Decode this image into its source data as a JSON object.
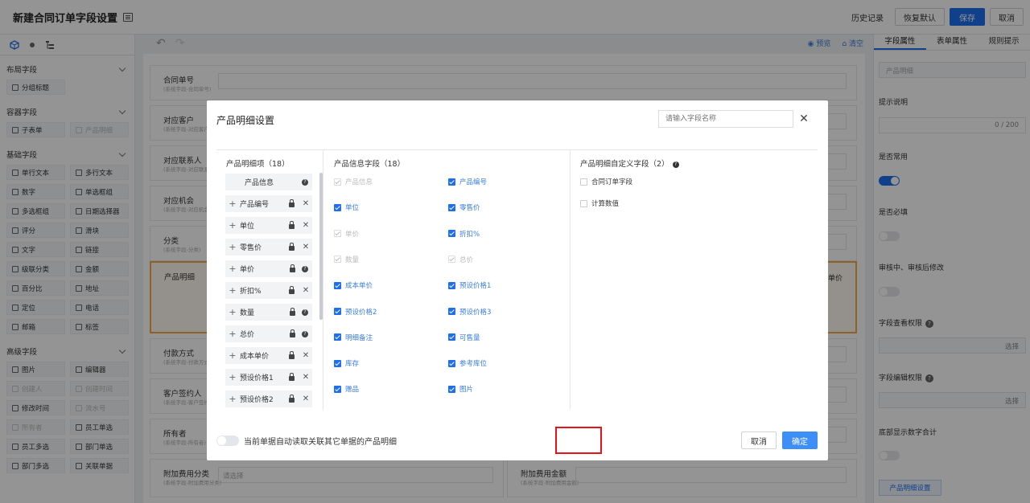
{
  "header": {
    "title": "新建合同订单字段设置",
    "history": "历史记录",
    "restore": "恢复默认",
    "save": "保存",
    "cancel": "取消"
  },
  "left": {
    "sections": [
      {
        "title": "布局字段",
        "items": [
          {
            "label": "分组标题",
            "disabled": false
          }
        ]
      },
      {
        "title": "容器字段",
        "items": [
          {
            "label": "子表单",
            "disabled": false
          },
          {
            "label": "产品明细",
            "disabled": true
          }
        ]
      },
      {
        "title": "基础字段",
        "items": [
          {
            "label": "单行文本",
            "disabled": false
          },
          {
            "label": "多行文本",
            "disabled": false
          },
          {
            "label": "数字",
            "disabled": false
          },
          {
            "label": "单选框组",
            "disabled": false
          },
          {
            "label": "多选框组",
            "disabled": false
          },
          {
            "label": "日期选择器",
            "disabled": false
          },
          {
            "label": "评分",
            "disabled": false
          },
          {
            "label": "滑块",
            "disabled": false
          },
          {
            "label": "文字",
            "disabled": false
          },
          {
            "label": "链接",
            "disabled": false
          },
          {
            "label": "级联分类",
            "disabled": false
          },
          {
            "label": "金额",
            "disabled": false
          },
          {
            "label": "百分比",
            "disabled": false
          },
          {
            "label": "地址",
            "disabled": false
          },
          {
            "label": "定位",
            "disabled": false
          },
          {
            "label": "电话",
            "disabled": false
          },
          {
            "label": "邮箱",
            "disabled": false
          },
          {
            "label": "标签",
            "disabled": false
          }
        ]
      },
      {
        "title": "高级字段",
        "items": [
          {
            "label": "图片",
            "disabled": false
          },
          {
            "label": "编辑器",
            "disabled": false
          },
          {
            "label": "创建人",
            "disabled": true
          },
          {
            "label": "创建时间",
            "disabled": true
          },
          {
            "label": "修改时间",
            "disabled": false
          },
          {
            "label": "流水号",
            "disabled": true
          },
          {
            "label": "所有者",
            "disabled": true
          },
          {
            "label": "员工单选",
            "disabled": false
          },
          {
            "label": "员工多选",
            "disabled": false
          },
          {
            "label": "部门单选",
            "disabled": false
          },
          {
            "label": "部门多选",
            "disabled": false
          },
          {
            "label": "关联单据",
            "disabled": false
          }
        ]
      }
    ]
  },
  "canvas": {
    "preview": "预览",
    "clear": "清空",
    "rows": [
      {
        "label": "合同单号",
        "sub": "(系统字段-合同单号)"
      },
      {
        "label": "对应客户",
        "sub": "(系统字段-对应客户)"
      },
      {
        "label": "对应联系人",
        "sub": "(系统字段-对应联系人)"
      },
      {
        "label": "对应机会",
        "sub": "(系统字段-对应机会)"
      },
      {
        "label": "分类",
        "sub": "(系统字段-分类)"
      },
      {
        "label": "产品明细",
        "sub": ""
      },
      {
        "label": "付款方式",
        "sub": "(系统字段-付款方式)"
      },
      {
        "label": "客户签约人",
        "sub": "(系统字段-客户签约人)"
      },
      {
        "label": "所有者",
        "sub": "(系统字段-所有者)"
      },
      {
        "label": "附加费用分类",
        "sub": "(系统字段-附加费用分类)"
      },
      {
        "label": "附加费用金额",
        "sub": "(系统字段-附加费用金额)"
      }
    ],
    "select_placeholder": "请选择",
    "side_label": "单价"
  },
  "right": {
    "tabs": [
      "字段属性",
      "表单属性",
      "规则提示"
    ],
    "field_name": "产品明细",
    "hint_label": "提示说明",
    "hint_count": "0 / 200",
    "common_label": "是否常用",
    "required_label": "是否必填",
    "edit_after_label": "审核中、审核后修改",
    "view_perm_label": "字段查看权限",
    "edit_perm_label": "字段编辑权限",
    "select_label": "选择",
    "bottom_sum_label": "底部显示数字合计",
    "settings_button": "产品明细设置"
  },
  "modal": {
    "title": "产品明细设置",
    "search_placeholder": "请输入字段名称",
    "close": "✕",
    "col1_title": "产品明细项（18）",
    "col1_items": [
      {
        "label": "产品信息",
        "type": "fixed"
      },
      {
        "label": "产品编号",
        "type": "lockx"
      },
      {
        "label": "单位",
        "type": "lockx"
      },
      {
        "label": "零售价",
        "type": "lockx"
      },
      {
        "label": "单价",
        "type": "lockq"
      },
      {
        "label": "折扣%",
        "type": "lockx"
      },
      {
        "label": "数量",
        "type": "lockq"
      },
      {
        "label": "总价",
        "type": "lockq"
      },
      {
        "label": "成本单价",
        "type": "lockx"
      },
      {
        "label": "预设价格1",
        "type": "lockx"
      },
      {
        "label": "预设价格2",
        "type": "lockx"
      }
    ],
    "col2_title": "产品信息字段（18）",
    "col2_left": [
      {
        "label": "产品信息",
        "state": "disabled"
      },
      {
        "label": "单位",
        "state": "checked"
      },
      {
        "label": "单价",
        "state": "disabled"
      },
      {
        "label": "数量",
        "state": "disabled"
      },
      {
        "label": "成本单价",
        "state": "checked"
      },
      {
        "label": "预设价格2",
        "state": "checked"
      },
      {
        "label": "明细备注",
        "state": "checked"
      },
      {
        "label": "库存",
        "state": "checked"
      },
      {
        "label": "赠品",
        "state": "checked"
      }
    ],
    "col2_right": [
      {
        "label": "产品编号",
        "state": "checked"
      },
      {
        "label": "零售价",
        "state": "checked"
      },
      {
        "label": "折扣%",
        "state": "checked"
      },
      {
        "label": "总价",
        "state": "disabled"
      },
      {
        "label": "预设价格1",
        "state": "checked"
      },
      {
        "label": "预设价格3",
        "state": "checked"
      },
      {
        "label": "可售量",
        "state": "checked"
      },
      {
        "label": "参考库位",
        "state": "checked"
      },
      {
        "label": "图片",
        "state": "checked"
      }
    ],
    "col3_title": "产品明细自定义字段（2）",
    "col3_items": [
      {
        "label": "合同订单字段"
      },
      {
        "label": "计算数值"
      }
    ],
    "footer_toggle_label": "当前单据自动读取关联其它单据的产品明细",
    "cancel": "取消",
    "ok": "确定"
  },
  "colors": {
    "primary": "#1e6ff0",
    "highlight": "#e8141b",
    "selected_border": "#f4a942"
  }
}
